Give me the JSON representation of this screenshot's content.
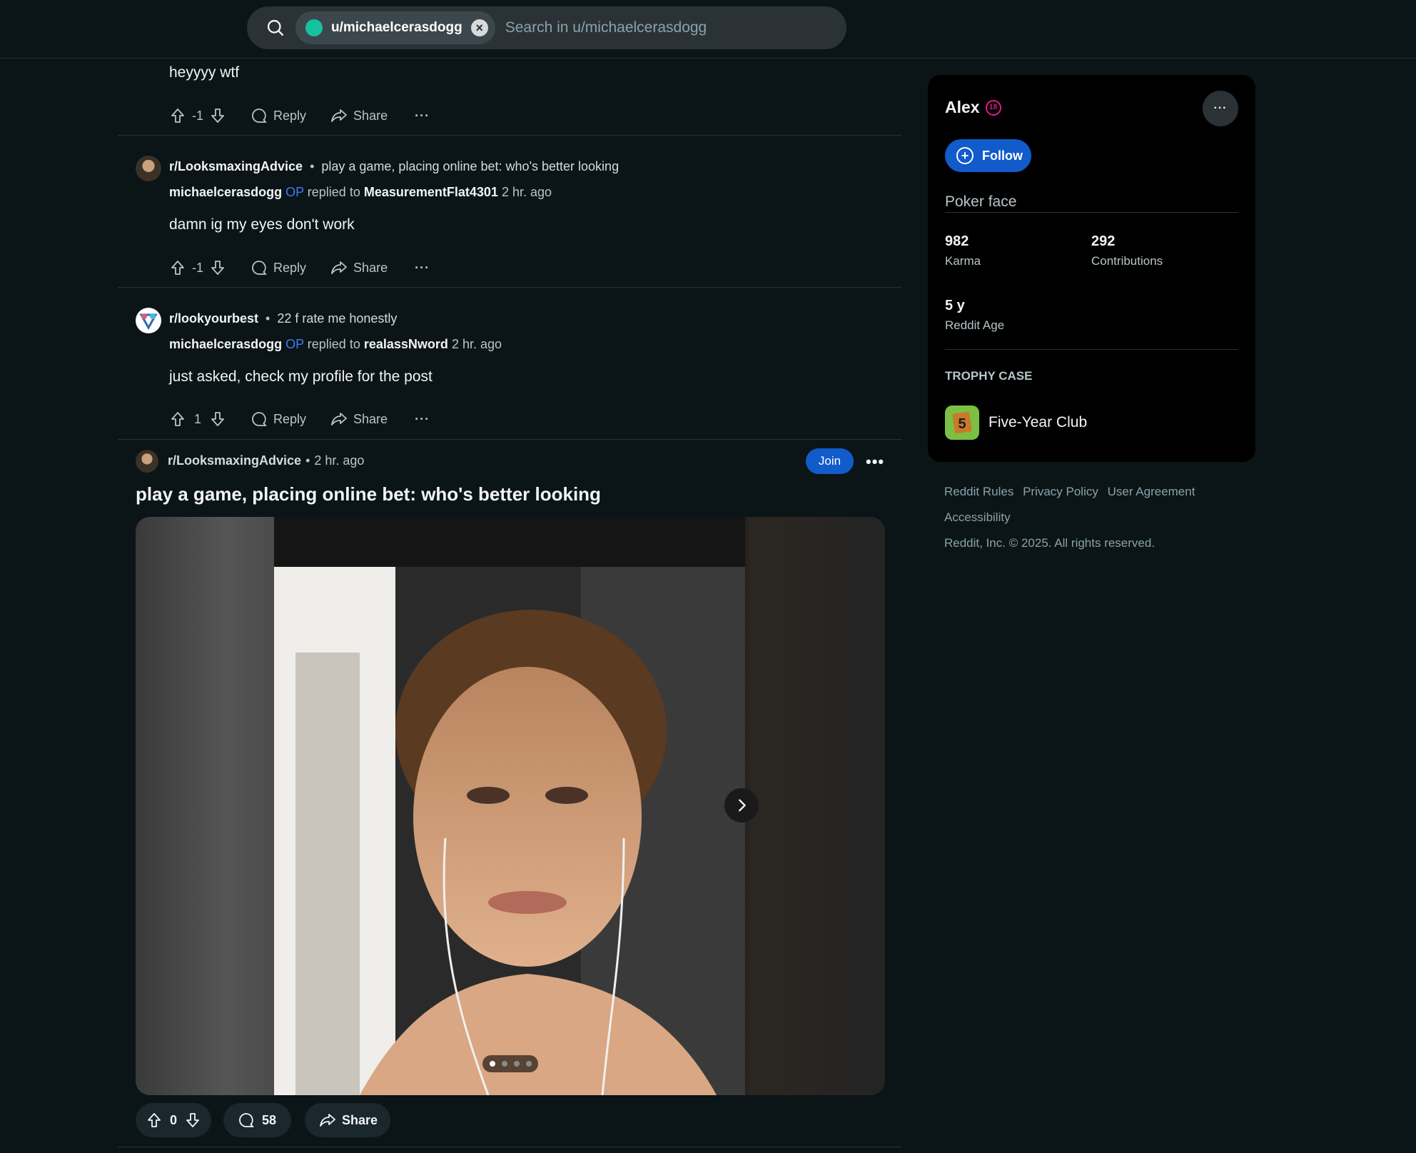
{
  "search": {
    "scope_chip": "u/michaelcerasdogg",
    "placeholder": "Search in u/michaelcerasdogg",
    "clear_label": "×"
  },
  "comments": [
    {
      "text": "heyyyy wtf",
      "votes": "-1",
      "reply_label": "Reply",
      "share_label": "Share",
      "more_label": "···"
    },
    {
      "subreddit": "r/LooksmaxingAdvice",
      "post_title": "play a game, placing online bet: who's better looking",
      "author": "michaelcerasdogg",
      "op_badge": "OP",
      "replied_to_label": "replied to",
      "replied_to": "MeasurementFlat4301",
      "time": "2 hr. ago",
      "text": "damn ig my eyes don't work",
      "votes": "-1",
      "reply_label": "Reply",
      "share_label": "Share",
      "more_label": "···"
    },
    {
      "subreddit": "r/lookyourbest",
      "post_title": "22 f rate me honestly",
      "author": "michaelcerasdogg",
      "op_badge": "OP",
      "replied_to_label": "replied to",
      "replied_to": "realassNword",
      "time": "2 hr. ago",
      "text": "just asked, check my profile for the post",
      "votes": "1",
      "reply_label": "Reply",
      "share_label": "Share",
      "more_label": "···"
    }
  ],
  "post": {
    "subreddit": "r/LooksmaxingAdvice",
    "time": "2 hr. ago",
    "join_label": "Join",
    "more_label": "•••",
    "title": "play a game, placing online bet: who's better looking",
    "votes": "0",
    "comments": "58",
    "share_label": "Share",
    "gallery_count": 4,
    "gallery_index": 1
  },
  "profile": {
    "name": "Alex",
    "nsfw_badge": "18",
    "more_label": "···",
    "follow_label": "Follow",
    "bio": "Poker face",
    "karma_value": "982",
    "karma_label": "Karma",
    "contrib_value": "292",
    "contrib_label": "Contributions",
    "age_value": "5 y",
    "age_label": "Reddit Age",
    "trophy_heading": "TROPHY CASE",
    "trophy_name": "Five-Year Club"
  },
  "footer": {
    "rules": "Reddit Rules",
    "privacy": "Privacy Policy",
    "agreement": "User Agreement",
    "accessibility": "Accessibility",
    "copyright": "Reddit, Inc. © 2025. All rights reserved."
  },
  "colors": {
    "background": "#0b1416",
    "accent_blue": "#115bca",
    "op_blue": "#3d7bf5",
    "nsfw_pink": "#e01a8a"
  }
}
